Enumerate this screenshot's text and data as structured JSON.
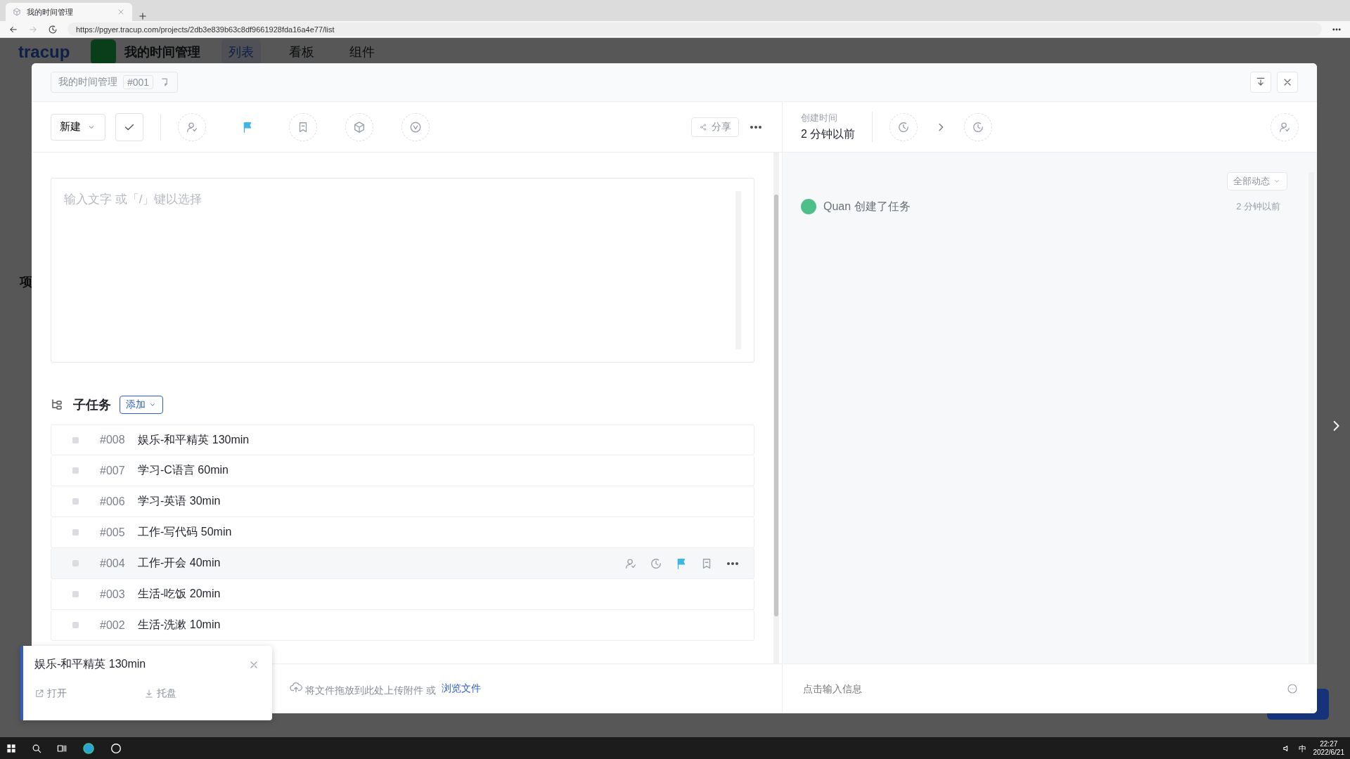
{
  "browser": {
    "tab_title": "我的时间管理",
    "url": "https://pgyer.tracup.com/projects/2db3e839b63c8df9661928fda16a4e77/list"
  },
  "background_app": {
    "logo": "tracup",
    "project_title": "我的时间管理",
    "views": [
      {
        "label": "列表",
        "selected": true
      },
      {
        "label": "看板",
        "selected": false
      },
      {
        "label": "组件",
        "selected": false
      }
    ],
    "sidebar_heading": "项"
  },
  "modal": {
    "breadcrumb": {
      "project": "我的时间管理",
      "id": "#001"
    },
    "toolbar": {
      "status": "新建",
      "share": "分享"
    },
    "created": {
      "label": "创建时间",
      "value": "2 分钟以前"
    },
    "editor": {
      "placeholder": "输入文字 或「/」键以选择"
    },
    "subtasks": {
      "title": "子任务",
      "add_button": "添加",
      "items": [
        {
          "id": "#008",
          "title": "娱乐-和平精英 130min",
          "hovered": false
        },
        {
          "id": "#007",
          "title": "学习-C语言 60min",
          "hovered": false
        },
        {
          "id": "#006",
          "title": "学习-英语 30min",
          "hovered": false
        },
        {
          "id": "#005",
          "title": "工作-写代码 50min",
          "hovered": false
        },
        {
          "id": "#004",
          "title": "工作-开会 40min",
          "hovered": true
        },
        {
          "id": "#003",
          "title": "生活-吃饭 20min",
          "hovered": false
        },
        {
          "id": "#002",
          "title": "生活-洗漱 10min",
          "hovered": false
        }
      ]
    },
    "upload": {
      "text": "将文件拖放到此处上传附件 或",
      "link": "浏览文件"
    },
    "activity": {
      "filter": "全部动态",
      "entries": [
        {
          "user": "Quan",
          "action": "创建了任务",
          "time": "2 分钟以前"
        }
      ]
    },
    "message_input": {
      "placeholder": "点击输入信息"
    }
  },
  "popup": {
    "title": "娱乐-和平精英 130min",
    "actions": [
      {
        "label": "打开"
      },
      {
        "label": "托盘"
      }
    ]
  },
  "taskbar": {
    "ime": "中",
    "time": "22:27",
    "date": "2022/6/21"
  }
}
